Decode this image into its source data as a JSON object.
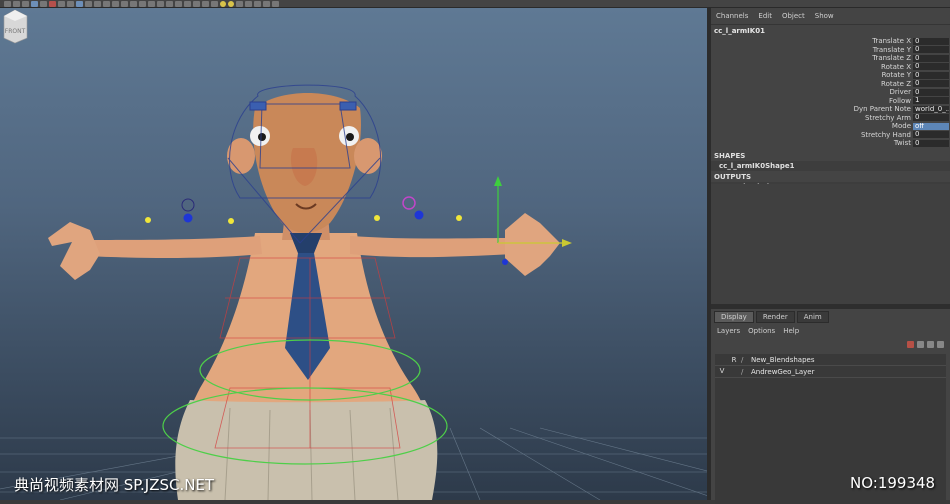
{
  "channel_box": {
    "menu": [
      "Channels",
      "Edit",
      "Object",
      "Show"
    ],
    "node_name": "cc_l_armIK01",
    "attributes": [
      {
        "name": "Translate X",
        "value": "0"
      },
      {
        "name": "Translate Y",
        "value": "0"
      },
      {
        "name": "Translate Z",
        "value": "0"
      },
      {
        "name": "Rotate X",
        "value": "0"
      },
      {
        "name": "Rotate Y",
        "value": "0"
      },
      {
        "name": "Rotate Z",
        "value": "0"
      },
      {
        "name": "Driver",
        "value": "0"
      },
      {
        "name": "Follow",
        "value": "1"
      },
      {
        "name": "Dyn Parent Note",
        "value": "world_0_..."
      },
      {
        "name": "Stretchy Arm",
        "value": "0"
      },
      {
        "name": "Mode",
        "value": "off"
      },
      {
        "name": "Stretchy Hand",
        "value": "0"
      },
      {
        "name": "Twist",
        "value": "0"
      }
    ],
    "shapes_title": "SHAPES",
    "shape_item": "cc_l_armIK0Shape1",
    "outputs_title": "OUTPUTS",
    "output_item": "StretchyLimb_L"
  },
  "layer_editor": {
    "tabs": [
      "Display",
      "Render",
      "Anim"
    ],
    "menu": [
      "Layers",
      "Options",
      "Help"
    ],
    "layers": [
      {
        "visibility": "",
        "type": "R",
        "name": "New_Blendshapes"
      },
      {
        "visibility": "V",
        "type": "",
        "name": "AndrewGeo_Layer"
      }
    ]
  },
  "viewport": {
    "viewcube_label": "FRONT"
  },
  "watermark": {
    "left": "典尚视频素材网 SP.JZSC.NET",
    "right": "NO:199348"
  }
}
